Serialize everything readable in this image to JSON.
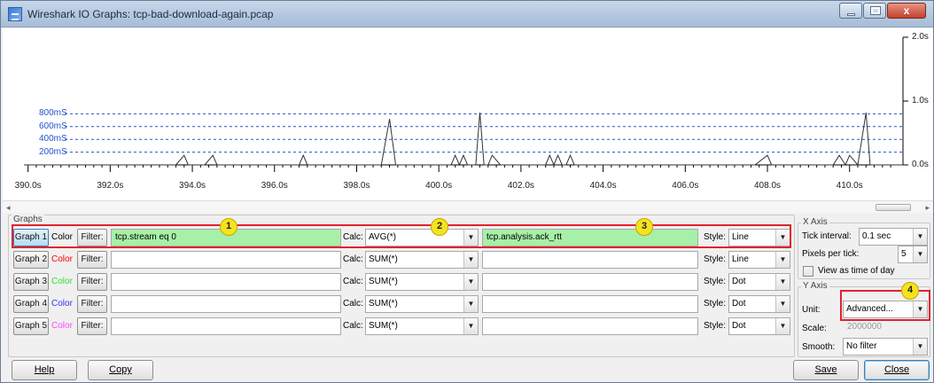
{
  "window": {
    "title": "Wireshark IO Graphs: tcp-bad-download-again.pcap",
    "minimize_glyph": "",
    "maximize_glyph": "",
    "close_glyph": "x"
  },
  "chart_data": {
    "type": "line",
    "x_tick_labels": [
      "390.0s",
      "392.0s",
      "394.0s",
      "396.0s",
      "398.0s",
      "400.0s",
      "402.0s",
      "404.0s",
      "406.0s",
      "408.0s",
      "410.0s"
    ],
    "right_axis_labels": [
      "2.0s",
      "1.0s",
      "0.0s"
    ],
    "left_axis_labels": [
      "800mS",
      "600mS",
      "400mS",
      "200mS"
    ],
    "xlim": [
      389.9,
      411.3
    ],
    "ylim": [
      0,
      2.0
    ],
    "series": [
      {
        "x": [
          389.9,
          390.5,
          391.0,
          391.3,
          391.5,
          392.0,
          392.2,
          393.0,
          393.6,
          393.8,
          393.9,
          394.0,
          394.3,
          394.5,
          394.6,
          394.8,
          395.0,
          396.0,
          396.3,
          396.6,
          396.7,
          396.8,
          397.0,
          398.0,
          398.6,
          398.8,
          398.95,
          399.2,
          400.0,
          400.3,
          400.4,
          400.5,
          400.6,
          400.7,
          400.8,
          400.9,
          401.0,
          401.1,
          401.2,
          401.3,
          401.5,
          402.0,
          402.3,
          402.6,
          402.7,
          402.8,
          402.9,
          403.0,
          403.1,
          403.2,
          403.3,
          403.5,
          404.0,
          405.0,
          406.0,
          407.0,
          407.7,
          408.0,
          408.1,
          408.3,
          409.0,
          409.3,
          409.6,
          409.75,
          409.9,
          410.0,
          410.2,
          410.4,
          410.5,
          410.6,
          410.8,
          411.3
        ],
        "y": [
          0.0,
          0.0,
          0.0,
          0.0,
          0.0,
          0.0,
          0.0,
          0.0,
          0.0,
          0.15,
          0.0,
          0.0,
          0.0,
          0.15,
          0.0,
          0.0,
          0.0,
          0.0,
          0.0,
          0.0,
          0.15,
          0.0,
          0.0,
          0.0,
          0.0,
          0.72,
          0.0,
          0.0,
          0.0,
          0.0,
          0.15,
          0.0,
          0.15,
          0.0,
          0.0,
          0.0,
          0.82,
          0.0,
          0.0,
          0.15,
          0.0,
          0.0,
          0.0,
          0.0,
          0.15,
          0.0,
          0.15,
          0.0,
          0.0,
          0.15,
          0.0,
          0.0,
          0.0,
          0.0,
          0.0,
          0.0,
          0.0,
          0.15,
          0.0,
          0.0,
          0.0,
          0.0,
          0.0,
          0.15,
          0.0,
          0.15,
          0.0,
          0.82,
          0.0,
          0.0,
          0.0,
          0.0
        ]
      }
    ],
    "dashed_reference_lines": [
      0.8,
      0.6,
      0.4,
      0.2
    ],
    "grid": false
  },
  "graphs": {
    "group_title": "Graphs",
    "color_label": "Color",
    "filter_label": "Filter:",
    "calc_label": "Calc:",
    "style_label": "Style:",
    "rows": [
      {
        "button": "Graph 1",
        "color": "#000000",
        "filter": "tcp.stream eq 0",
        "calc": "AVG(*)",
        "calc_field": "tcp.analysis.ack_rtt",
        "style": "Line"
      },
      {
        "button": "Graph 2",
        "color": "#ff0000",
        "filter": "",
        "calc": "SUM(*)",
        "calc_field": "",
        "style": "Line"
      },
      {
        "button": "Graph 3",
        "color": "#33dd33",
        "filter": "",
        "calc": "SUM(*)",
        "calc_field": "",
        "style": "Dot"
      },
      {
        "button": "Graph 4",
        "color": "#3333ff",
        "filter": "",
        "calc": "SUM(*)",
        "calc_field": "",
        "style": "Dot"
      },
      {
        "button": "Graph 5",
        "color": "#ff44ff",
        "filter": "",
        "calc": "SUM(*)",
        "calc_field": "",
        "style": "Dot"
      }
    ]
  },
  "callouts": [
    "1",
    "2",
    "3",
    "4"
  ],
  "x_axis": {
    "group_title": "X Axis",
    "tick_interval_label": "Tick interval:",
    "tick_interval_value": "0.1 sec",
    "pixels_per_tick_label": "Pixels per tick:",
    "pixels_per_tick_value": "5",
    "view_as_time_label": "View as time of day"
  },
  "y_axis": {
    "group_title": "Y Axis",
    "unit_label": "Unit:",
    "unit_value": "Advanced...",
    "scale_label": "Scale:",
    "scale_value": "2000000",
    "smooth_label": "Smooth:",
    "smooth_value": "No filter"
  },
  "buttons": {
    "help": "Help",
    "copy": "Copy",
    "save": "Save",
    "close": "Close"
  },
  "colors": {
    "highlight": "#e0232e",
    "badge": "#f5e320",
    "filter_active_bg": "#a7f0a7",
    "reference_line": "#2255cc"
  }
}
